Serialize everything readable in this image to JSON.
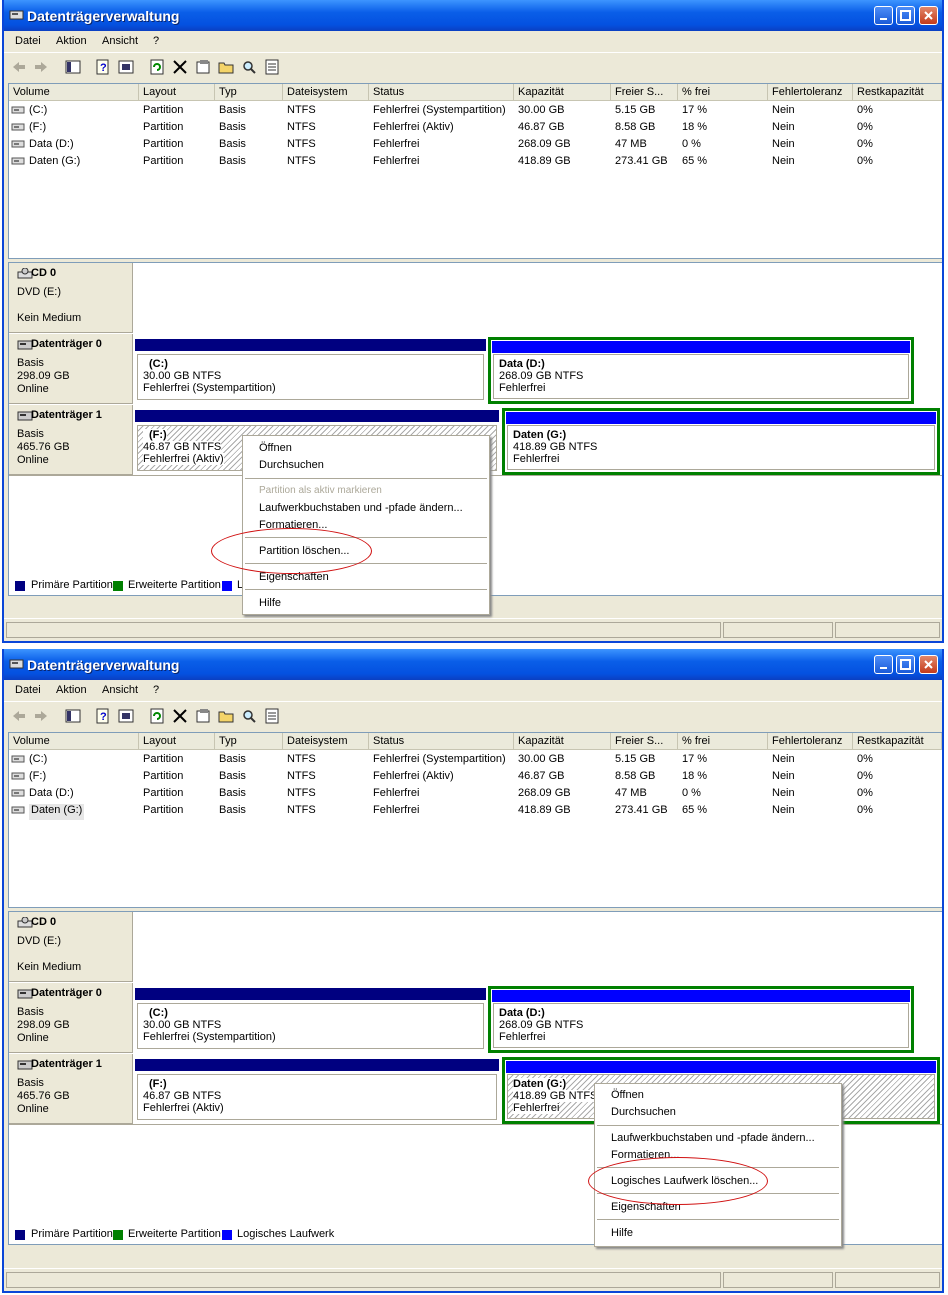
{
  "window_title": "Datenträgerverwaltung",
  "menu": [
    "Datei",
    "Aktion",
    "Ansicht",
    "?"
  ],
  "columns": [
    "Volume",
    "Layout",
    "Typ",
    "Dateisystem",
    "Status",
    "Kapazität",
    "Freier S...",
    "% frei",
    "Fehlertoleranz",
    "Restkapazität"
  ],
  "volumes": [
    {
      "volume": "(C:)",
      "layout": "Partition",
      "typ": "Basis",
      "fs": "NTFS",
      "status": "Fehlerfrei (Systempartition)",
      "cap": "30.00 GB",
      "free": "5.15 GB",
      "pct": "17 %",
      "ft": "Nein",
      "rest": "0%"
    },
    {
      "volume": "(F:)",
      "layout": "Partition",
      "typ": "Basis",
      "fs": "NTFS",
      "status": "Fehlerfrei (Aktiv)",
      "cap": "46.87 GB",
      "free": "8.58 GB",
      "pct": "18 %",
      "ft": "Nein",
      "rest": "0%"
    },
    {
      "volume": "Data (D:)",
      "layout": "Partition",
      "typ": "Basis",
      "fs": "NTFS",
      "status": "Fehlerfrei",
      "cap": "268.09 GB",
      "free": "47 MB",
      "pct": "0 %",
      "ft": "Nein",
      "rest": "0%"
    },
    {
      "volume": "Daten (G:)",
      "layout": "Partition",
      "typ": "Basis",
      "fs": "NTFS",
      "status": "Fehlerfrei",
      "cap": "418.89 GB",
      "free": "273.41 GB",
      "pct": "65 %",
      "ft": "Nein",
      "rest": "0%"
    }
  ],
  "cd": {
    "name": "CD 0",
    "line1": "DVD (E:)",
    "line2": "Kein Medium"
  },
  "disk0": {
    "name": "Datenträger 0",
    "type": "Basis",
    "size": "298.09 GB",
    "state": "Online",
    "p1": {
      "title": "(C:)",
      "size": "30.00 GB NTFS",
      "status": "Fehlerfrei (Systempartition)"
    },
    "p2": {
      "title": "Data  (D:)",
      "size": "268.09 GB NTFS",
      "status": "Fehlerfrei"
    }
  },
  "disk1": {
    "name": "Datenträger 1",
    "type": "Basis",
    "size": "465.76 GB",
    "state": "Online",
    "p1": {
      "title": "(F:)",
      "size": "46.87 GB NTFS",
      "status": "Fehlerfrei (Aktiv)"
    },
    "p2": {
      "title": "Daten  (G:)",
      "size": "418.89 GB NTFS",
      "status": "Fehlerfrei"
    }
  },
  "legend": {
    "primary": "Primäre Partition",
    "extended": "Erweiterte Partition",
    "logical": "Logisches Laufwerk"
  },
  "colors": {
    "primary": "#000080",
    "extended": "#008000",
    "logical": "#0000ff"
  },
  "ctx1": {
    "open": "Öffnen",
    "explore": "Durchsuchen",
    "mark_active": "Partition als aktiv markieren",
    "change_letter": "Laufwerkbuchstaben und -pfade ändern...",
    "format": "Formatieren...",
    "delete": "Partition löschen...",
    "props": "Eigenschaften",
    "help": "Hilfe"
  },
  "ctx2": {
    "open": "Öffnen",
    "explore": "Durchsuchen",
    "change_letter": "Laufwerkbuchstaben und -pfade ändern...",
    "format": "Formatieren...",
    "delete": "Logisches Laufwerk löschen...",
    "props": "Eigenschaften",
    "help": "Hilfe"
  }
}
